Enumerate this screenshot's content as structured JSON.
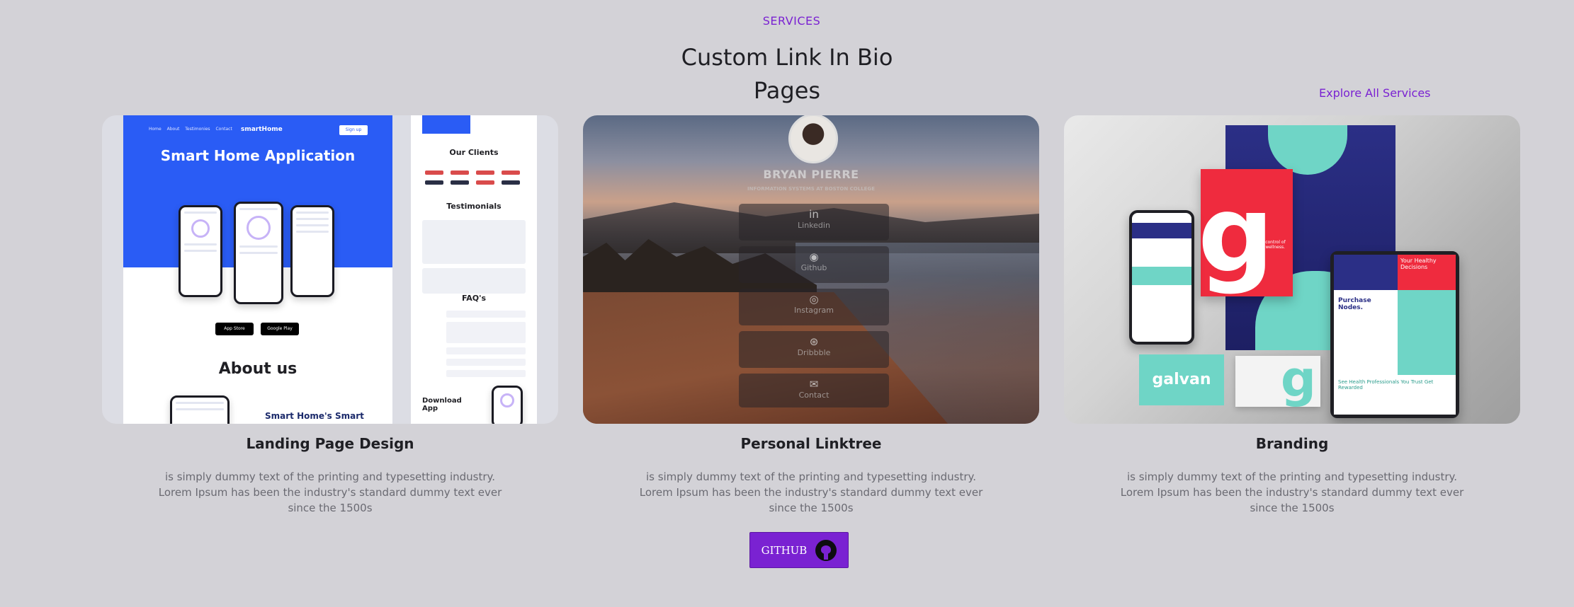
{
  "section": {
    "eyebrow": "SERVICES",
    "title": "Custom Link In Bio Pages",
    "explore_link": "Explore All Services"
  },
  "cards": [
    {
      "title": "Landing Page Design",
      "description": "is simply dummy text of the printing and typesetting industry. Lorem Ipsum has been the industry's standard dummy text ever since the 1500s",
      "mockup": {
        "nav": "Home About Testimonies Contact",
        "brand": "smartHome",
        "signup": "Sign up",
        "hero_title": "Smart Home Application",
        "about_heading": "About us",
        "about_sub": "Smart Home's Smart",
        "clients_heading": "Our Clients",
        "testimonials_heading": "Testimonials",
        "faq_heading": "FAQ's",
        "download_heading": "Download App",
        "store_apple": "App Store",
        "store_google": "Google Play"
      }
    },
    {
      "title": "Personal Linktree",
      "description": "is simply dummy text of the printing and typesetting industry. Lorem Ipsum has been the industry's standard dummy text ever since the 1500s",
      "mockup": {
        "name": "BRYAN PIERRE",
        "role": "INFORMATION SYSTEMS AT BOSTON COLLEGE",
        "links": [
          {
            "label": "Linkedin",
            "icon": "linkedin-icon",
            "glyph": "in"
          },
          {
            "label": "Github",
            "icon": "github-icon",
            "glyph": "◉"
          },
          {
            "label": "Instagram",
            "icon": "instagram-icon",
            "glyph": "◎"
          },
          {
            "label": "Dribbble",
            "icon": "dribbble-icon",
            "glyph": "⊛"
          },
          {
            "label": "Contact",
            "icon": "mail-icon",
            "glyph": "✉"
          }
        ]
      }
    },
    {
      "title": "Branding",
      "description": "is simply dummy text of the printing and typesetting industry. Lorem Ipsum has been the industry's standard dummy text ever since the 1500s",
      "mockup": {
        "logo_text": "galvan",
        "red_card_text": "Take control of your wellness.",
        "tablet_heading": "Purchase Nodes.",
        "tablet_red_text": "Your Healthy Decisions",
        "tablet_footer": "See Health Professionals You Trust Get Rewarded"
      }
    }
  ],
  "github_button": {
    "label": "GITHUB",
    "icon": "github-icon"
  },
  "colors": {
    "background": "#d3d2d7",
    "accent": "#7a22d2"
  }
}
